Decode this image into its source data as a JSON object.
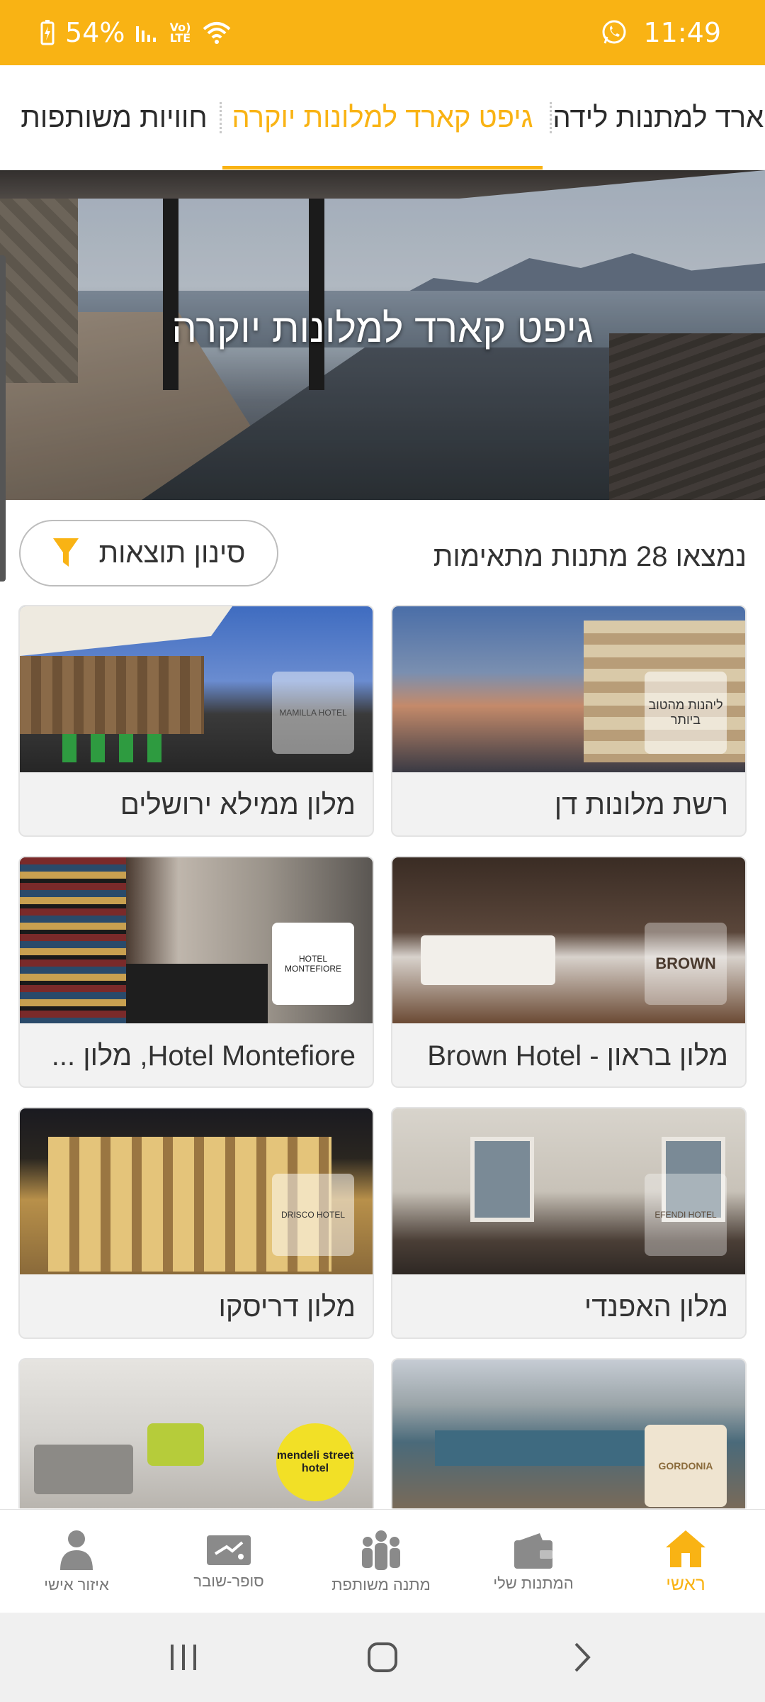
{
  "status_bar": {
    "time": "11:49",
    "battery": "54%",
    "signal_label": "Vo) LTE",
    "icons": [
      "battery-charging-icon",
      "signal-icon",
      "wifi-icon",
      "whatsapp-icon"
    ]
  },
  "tabs": [
    {
      "label": "חוויות משותפות",
      "active": false
    },
    {
      "label": "גיפט קארד למלונות יוקרה",
      "active": true
    },
    {
      "label": "גיפט קארד למתנות לידה",
      "active": false
    }
  ],
  "hero": {
    "title": "גיפט קארד למלונות יוקרה"
  },
  "results": {
    "count_text": "נמצאו 28 מתנות מתאימות",
    "filter_label": "סינון תוצאות",
    "filter_icon": "funnel-icon"
  },
  "cards": [
    {
      "title": "רשת מלונות דן",
      "logo_text": "ליהנות מהטוב ביותר"
    },
    {
      "title": "מלון ממילא ירושלים",
      "logo_text": "MAMILLA HOTEL"
    },
    {
      "title": "מלון בראון - Brown Hotel",
      "logo_text": "BROWN"
    },
    {
      "title": "Hotel Montefiore, מלון ...",
      "logo_text": "HOTEL MONTEFIORE"
    },
    {
      "title": "מלון האפנדי",
      "logo_text": "EFENDI HOTEL"
    },
    {
      "title": "מלון דריסקו",
      "logo_text": "DRISCO HOTEL"
    },
    {
      "title": "",
      "logo_text": "GORDONIA"
    },
    {
      "title": "",
      "logo_text": "mendeli street hotel"
    }
  ],
  "bottom_nav": [
    {
      "label": "ראשי",
      "icon": "home-icon",
      "active": true
    },
    {
      "label": "המתנות שלי",
      "icon": "wallet-icon",
      "active": false
    },
    {
      "label": "מתנה משותפת",
      "icon": "group-icon",
      "active": false
    },
    {
      "label": "סופר-שובר",
      "icon": "voucher-icon",
      "active": false
    },
    {
      "label": "איזור אישי",
      "icon": "person-icon",
      "active": false
    }
  ],
  "colors": {
    "accent": "#f9b314",
    "text": "#333333",
    "inactive_nav": "#777777"
  }
}
